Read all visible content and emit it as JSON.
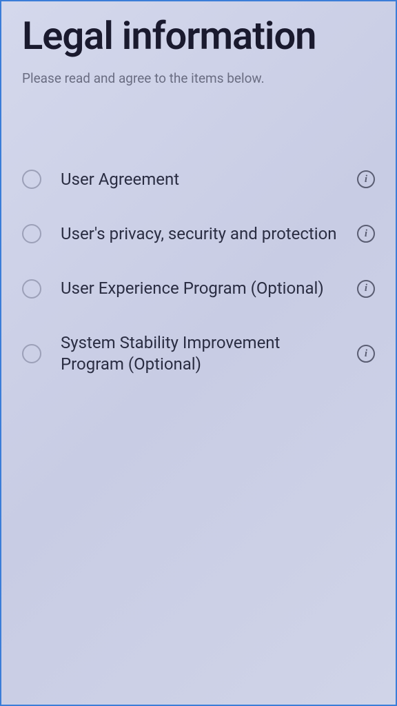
{
  "header": {
    "title": "Legal information",
    "subtitle": "Please read and agree to the items below."
  },
  "items": [
    {
      "label": "User Agreement"
    },
    {
      "label": "User's privacy, security and protection"
    },
    {
      "label": "User Experience Program (Optional)"
    },
    {
      "label": "System Stability Improvement Program (Optional)"
    }
  ],
  "info_glyph": "i"
}
